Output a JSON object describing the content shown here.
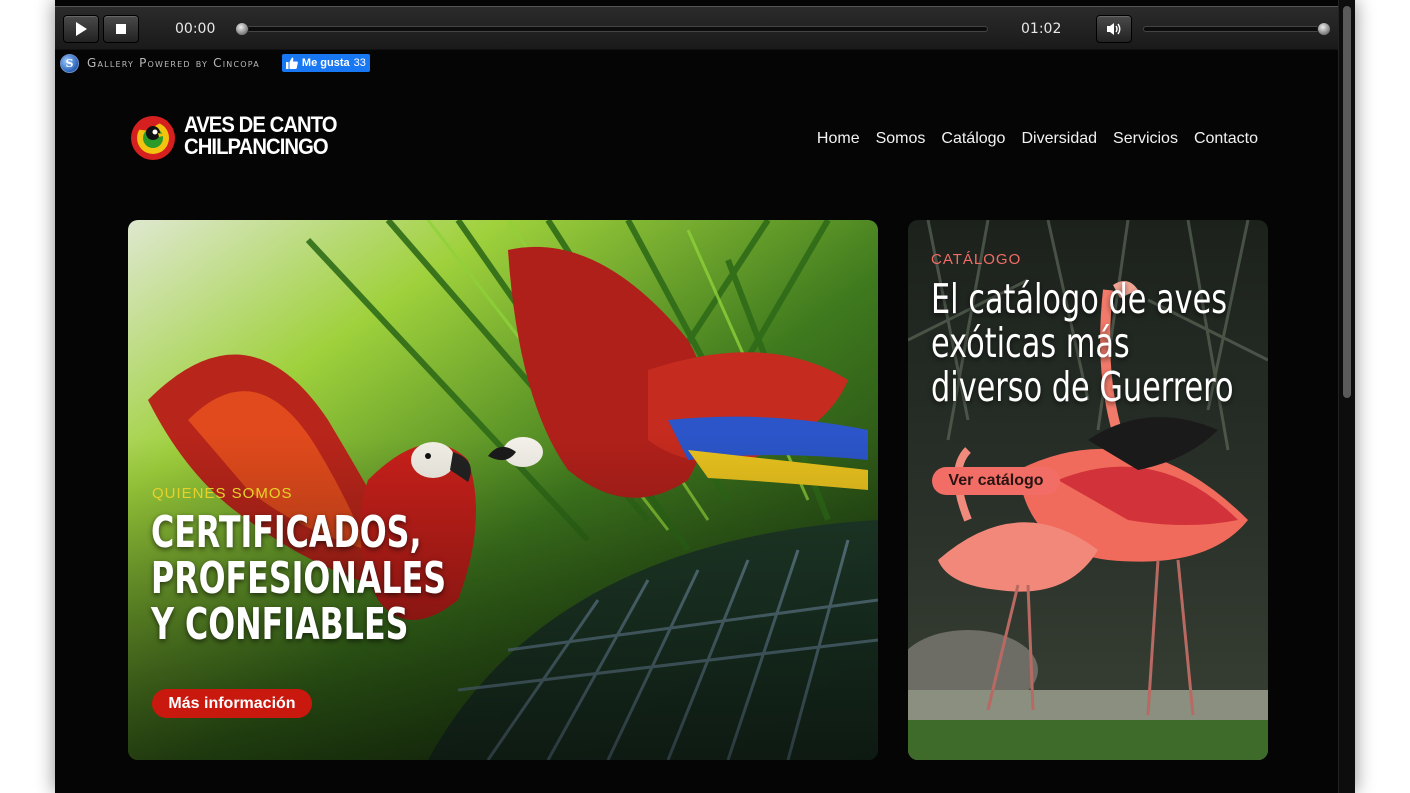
{
  "player": {
    "current_time": "00:00",
    "duration": "01:02",
    "progress": 0.0,
    "volume": 1.0,
    "icons": [
      "play-icon",
      "stop-icon",
      "volume-icon"
    ]
  },
  "gallery": {
    "powered_text": "Gallery Powered by Cincopa",
    "fb_like_label": "Me gusta",
    "fb_like_count": "33"
  },
  "site": {
    "logo_line1": "AVES DE CANTO",
    "logo_line2": "CHILPANCINGO",
    "nav": [
      "Home",
      "Somos",
      "Catálogo",
      "Diversidad",
      "Servicios",
      "Contacto"
    ]
  },
  "hero": {
    "eyebrow": "QUIENES SOMOS",
    "headline_lines": [
      "CERTIFICADOS,",
      "PROFESIONALES",
      "Y CONFIABLES"
    ],
    "button_label": "Más información",
    "eyebrow_color": "#e7d22a",
    "button_color": "#c9180e"
  },
  "catalog_card": {
    "eyebrow": "CATÁLOGO",
    "headline_lines": [
      "El catálogo de aves",
      "exóticas más",
      "diverso de Guerrero"
    ],
    "button_label": "Ver catálogo",
    "accent_color": "#f26d66"
  }
}
